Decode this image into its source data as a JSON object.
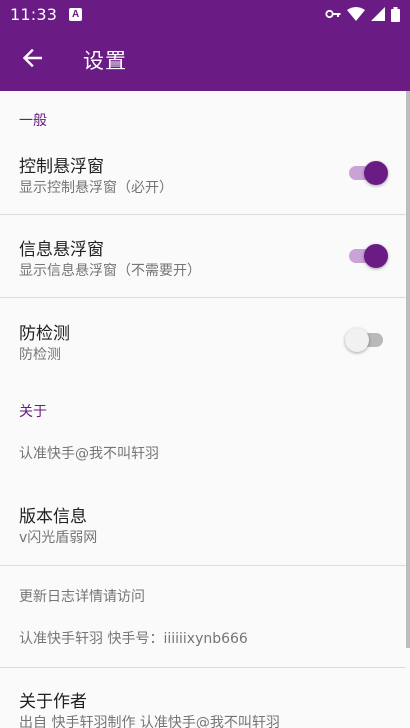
{
  "status_bar": {
    "time": "11:33",
    "notification_glyph": "A",
    "icons": [
      "vpn-key-icon",
      "wifi-icon",
      "signal-icon",
      "battery-icon"
    ]
  },
  "app_bar": {
    "title": "设置",
    "back_icon": "arrow-left-icon",
    "color": "#6a1b84"
  },
  "sections": {
    "general": {
      "header": "一般",
      "items": [
        {
          "title": "控制悬浮窗",
          "summary": "显示控制悬浮窗（必开）",
          "enabled": true
        },
        {
          "title": "信息悬浮窗",
          "summary": "显示信息悬浮窗（不需要开）",
          "enabled": true
        },
        {
          "title": "防检测",
          "summary": "防检测",
          "enabled": false
        }
      ]
    },
    "about": {
      "header": "关于",
      "note1": "认准快手@我不叫轩羽",
      "version": {
        "title": "版本信息",
        "summary": "v闪光盾弱网"
      },
      "changelog": "更新日志详情请访问",
      "contact": "认准快手轩羽 快手号：iiiiiixynb666",
      "author": {
        "title": "关于作者",
        "summary": "出自 快手轩羽制作 认准快手@我不叫轩羽"
      }
    }
  },
  "colors": {
    "accent": "#6a1b84",
    "switch_track_on": "#c9a2d6",
    "switch_off": "#f1f1f1"
  }
}
